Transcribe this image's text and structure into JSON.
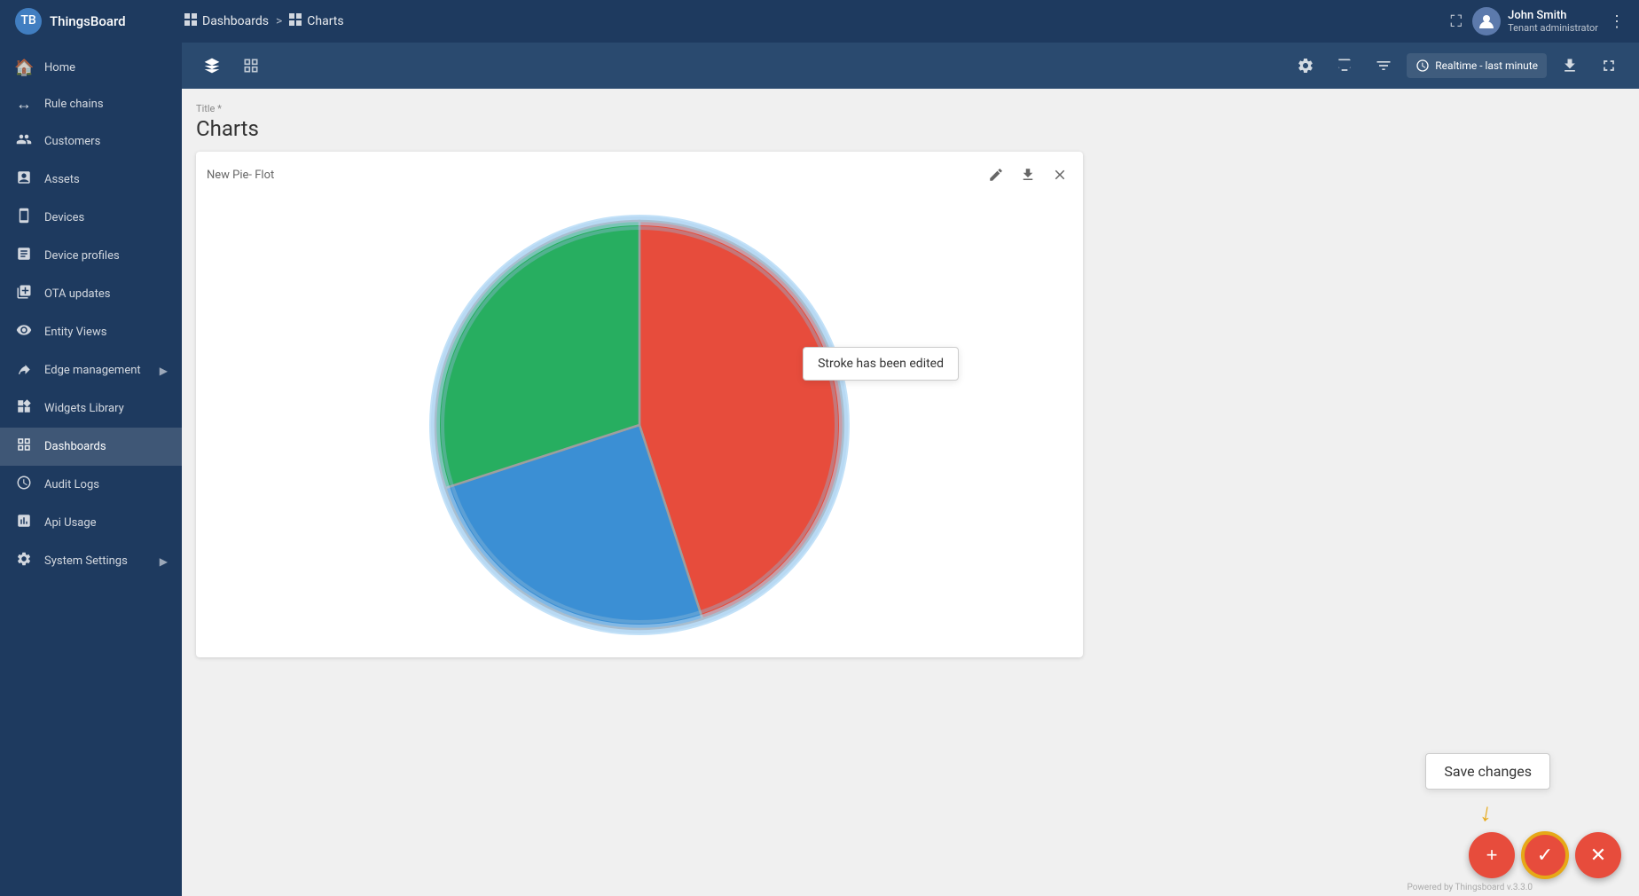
{
  "app": {
    "name": "ThingsBoard"
  },
  "breadcrumb": {
    "dashboards_label": "Dashboards",
    "separator": ">",
    "current_label": "Charts"
  },
  "user": {
    "name": "John Smith",
    "role": "Tenant administrator"
  },
  "sidebar": {
    "items": [
      {
        "id": "home",
        "label": "Home",
        "icon": "🏠"
      },
      {
        "id": "rule-chains",
        "label": "Rule chains",
        "icon": "↔"
      },
      {
        "id": "customers",
        "label": "Customers",
        "icon": "👥"
      },
      {
        "id": "assets",
        "label": "Assets",
        "icon": "📦"
      },
      {
        "id": "devices",
        "label": "Devices",
        "icon": "📱"
      },
      {
        "id": "device-profiles",
        "label": "Device profiles",
        "icon": "📋"
      },
      {
        "id": "ota-updates",
        "label": "OTA updates",
        "icon": "⬆"
      },
      {
        "id": "entity-views",
        "label": "Entity Views",
        "icon": "👁"
      },
      {
        "id": "edge-management",
        "label": "Edge management",
        "icon": "⬡",
        "has_children": true
      },
      {
        "id": "widgets-library",
        "label": "Widgets Library",
        "icon": "🧩"
      },
      {
        "id": "dashboards",
        "label": "Dashboards",
        "icon": "⊞",
        "active": true
      },
      {
        "id": "audit-logs",
        "label": "Audit Logs",
        "icon": "📜"
      },
      {
        "id": "api-usage",
        "label": "Api Usage",
        "icon": "📊"
      },
      {
        "id": "system-settings",
        "label": "System Settings",
        "icon": "⚙",
        "has_children": true
      }
    ]
  },
  "toolbar": {
    "view_mode_icon": "◆",
    "table_mode_icon": "⊞"
  },
  "realtime": {
    "label": "Realtime - last minute"
  },
  "page": {
    "title_label": "Title *",
    "title": "Charts"
  },
  "widget": {
    "title": "New Pie- Flot",
    "tooltip_text": "Stroke has been edited"
  },
  "pie_chart": {
    "segments": [
      {
        "label": "Red",
        "value": 45,
        "color": "#e74c3c"
      },
      {
        "label": "Blue",
        "value": 25,
        "color": "#3498db"
      },
      {
        "label": "Green",
        "value": 30,
        "color": "#27ae60"
      }
    ]
  },
  "actions": {
    "save_changes_label": "Save changes",
    "add_icon": "+",
    "confirm_icon": "✓",
    "cancel_icon": "✕"
  },
  "footer": {
    "powered_by": "Powered by Thingsboard v.3.3.0"
  }
}
